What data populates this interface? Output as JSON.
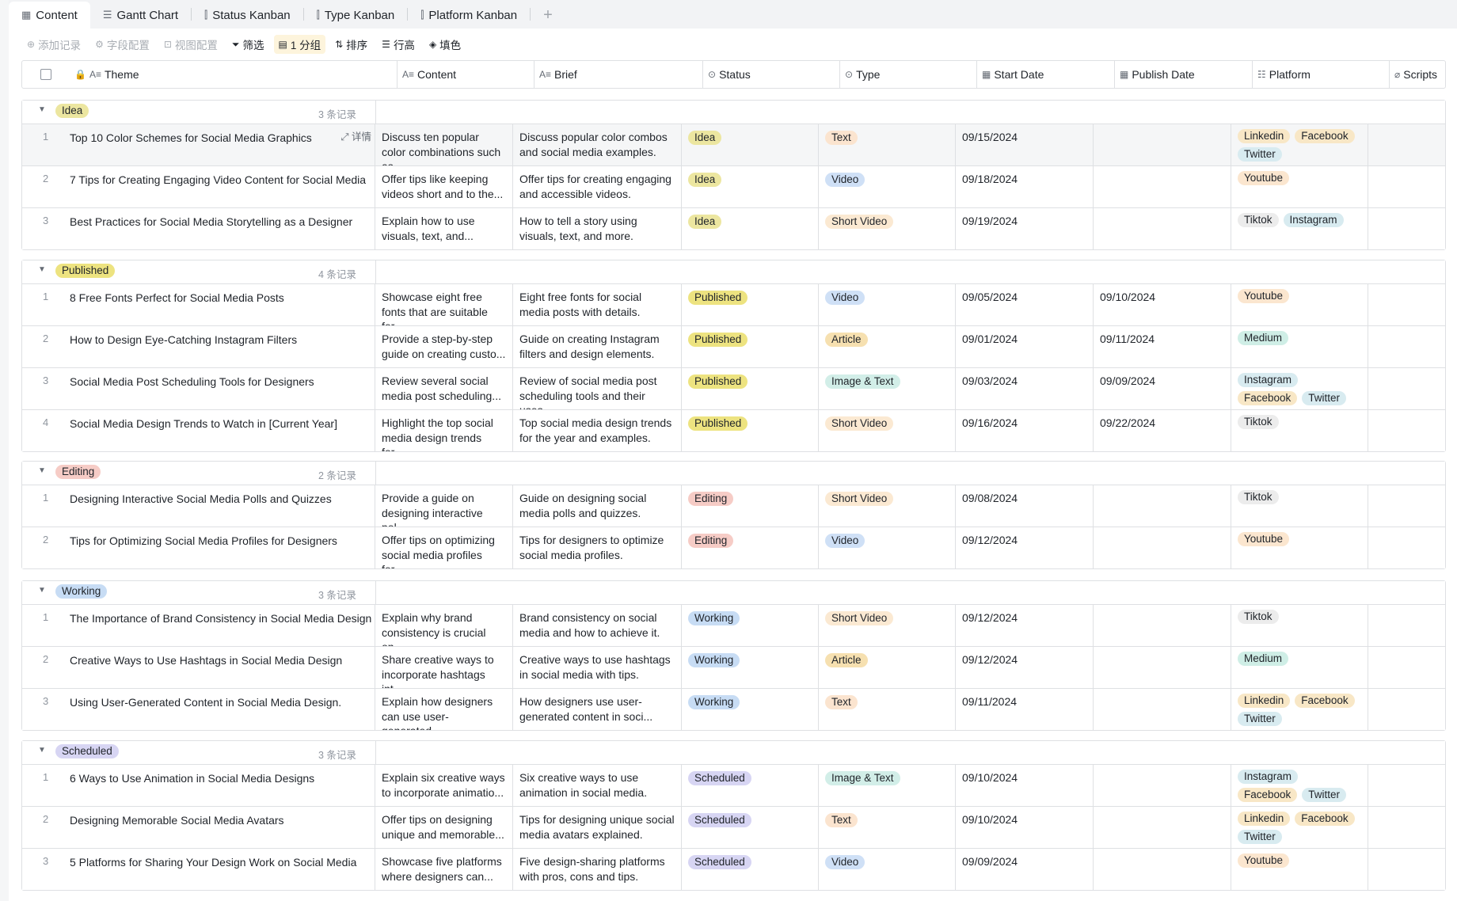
{
  "tabs": [
    {
      "label": "Content",
      "icon": "grid-table-icon",
      "active": true
    },
    {
      "label": "Gantt Chart",
      "icon": "gantt-icon",
      "active": false
    },
    {
      "label": "Status Kanban",
      "icon": "kanban-icon",
      "active": false
    },
    {
      "label": "Type Kanban",
      "icon": "kanban-icon",
      "active": false
    },
    {
      "label": "Platform Kanban",
      "icon": "kanban-icon",
      "active": false
    }
  ],
  "toolbar": {
    "add_record": "添加记录",
    "field_config": "字段配置",
    "view_config": "视图配置",
    "filter": "筛选",
    "group": "1 分组",
    "sort": "排序",
    "row_height": "行高",
    "fill_color": "填色"
  },
  "columns": {
    "theme": "Theme",
    "content": "Content",
    "brief": "Brief",
    "status": "Status",
    "type": "Type",
    "start_date": "Start Date",
    "publish_date": "Publish Date",
    "platform": "Platform",
    "scripts": "Scripts"
  },
  "detail_label": "详情",
  "groups": [
    {
      "label": "Idea",
      "count": "3 条记录",
      "status_class": "idea",
      "rows": [
        {
          "num": "1",
          "theme": "Top 10 Color Schemes for Social Media Graphics",
          "content": "Discuss ten popular color combinations such as...",
          "brief": "Discuss popular color combos and social media examples.",
          "status": "Idea",
          "type": "Text",
          "start": "09/15/2024",
          "publish": "",
          "platforms": [
            "Linkedin",
            "Facebook",
            "Twitter"
          ],
          "highlight": true
        },
        {
          "num": "2",
          "theme": "7 Tips for Creating Engaging Video Content for Social Media",
          "content": "Offer tips like keeping videos short and to the...",
          "brief": "Offer tips for creating engaging and accessible videos.",
          "status": "Idea",
          "type": "Video",
          "start": "09/18/2024",
          "publish": "",
          "platforms": [
            "Youtube"
          ]
        },
        {
          "num": "3",
          "theme": "Best Practices for Social Media Storytelling as a Designer",
          "content": "Explain how to use visuals, text, and...",
          "brief": "How to tell a story using visuals, text, and more.",
          "status": "Idea",
          "type": "Short Video",
          "start": "09/19/2024",
          "publish": "",
          "platforms": [
            "Tiktok",
            "Instagram"
          ]
        }
      ]
    },
    {
      "label": "Published",
      "count": "4 条记录",
      "status_class": "published",
      "rows": [
        {
          "num": "1",
          "theme": "8 Free Fonts Perfect for Social Media Posts",
          "content": "Showcase eight free fonts that are suitable for...",
          "brief": "Eight free fonts for social media posts with details.",
          "status": "Published",
          "type": "Video",
          "start": "09/05/2024",
          "publish": "09/10/2024",
          "platforms": [
            "Youtube"
          ]
        },
        {
          "num": "2",
          "theme": "How to Design Eye-Catching Instagram Filters",
          "content": "Provide a step-by-step guide on creating custo...",
          "brief": "Guide on creating Instagram filters and design elements.",
          "status": "Published",
          "type": "Article",
          "start": "09/01/2024",
          "publish": "09/11/2024",
          "platforms": [
            "Medium"
          ]
        },
        {
          "num": "3",
          "theme": "Social Media Post Scheduling Tools for Designers",
          "content": "Review several social media post scheduling...",
          "brief": "Review of social media post scheduling tools and their uses.",
          "status": "Published",
          "type": "Image & Text",
          "start": "09/03/2024",
          "publish": "09/09/2024",
          "platforms": [
            "Instagram",
            "Facebook",
            "Twitter"
          ]
        },
        {
          "num": "4",
          "theme": "Social Media Design Trends to Watch in [Current Year]",
          "content": "Highlight the top social media design trends for...",
          "brief": "Top social media design trends for the year and examples.",
          "status": "Published",
          "type": "Short Video",
          "start": "09/16/2024",
          "publish": "09/22/2024",
          "platforms": [
            "Tiktok"
          ]
        }
      ]
    },
    {
      "label": "Editing",
      "count": "2 条记录",
      "status_class": "editing",
      "rows": [
        {
          "num": "1",
          "theme": "Designing Interactive Social Media Polls and Quizzes",
          "content": "Provide a guide on designing interactive pol...",
          "brief": "Guide on designing social media polls and quizzes.",
          "status": "Editing",
          "type": "Short Video",
          "start": "09/08/2024",
          "publish": "",
          "platforms": [
            "Tiktok"
          ]
        },
        {
          "num": "2",
          "theme": "Tips for Optimizing Social Media Profiles for Designers",
          "content": "Offer tips on optimizing social media profiles for...",
          "brief": "Tips for designers to optimize social media profiles.",
          "status": "Editing",
          "type": "Video",
          "start": "09/12/2024",
          "publish": "",
          "platforms": [
            "Youtube"
          ]
        }
      ]
    },
    {
      "label": "Working",
      "count": "3 条记录",
      "status_class": "working",
      "rows": [
        {
          "num": "1",
          "theme": "The Importance of Brand Consistency in Social Media Design",
          "content": "Explain why brand consistency is crucial on...",
          "brief": "Brand consistency on social media and how to achieve it.",
          "status": "Working",
          "type": "Short Video",
          "start": "09/12/2024",
          "publish": "",
          "platforms": [
            "Tiktok"
          ]
        },
        {
          "num": "2",
          "theme": "Creative Ways to Use Hashtags in Social Media Design",
          "content": "Share creative ways to incorporate hashtags int...",
          "brief": "Creative ways to use hashtags in social media with tips.",
          "status": "Working",
          "type": "Article",
          "start": "09/12/2024",
          "publish": "",
          "platforms": [
            "Medium"
          ]
        },
        {
          "num": "3",
          "theme": "Using User-Generated Content in Social Media Design.",
          "content": "Explain how designers can use user-generated...",
          "brief": "How designers use user-generated content in soci...",
          "status": "Working",
          "type": "Text",
          "start": "09/11/2024",
          "publish": "",
          "platforms": [
            "Linkedin",
            "Facebook",
            "Twitter"
          ]
        }
      ]
    },
    {
      "label": "Scheduled",
      "count": "3 条记录",
      "status_class": "scheduled",
      "rows": [
        {
          "num": "1",
          "theme": "6 Ways to Use Animation in Social Media Designs",
          "content": "Explain six creative ways to incorporate animatio...",
          "brief": "Six creative ways to use animation in social media.",
          "status": "Scheduled",
          "type": "Image & Text",
          "start": "09/10/2024",
          "publish": "",
          "platforms": [
            "Instagram",
            "Facebook",
            "Twitter"
          ]
        },
        {
          "num": "2",
          "theme": "Designing Memorable Social Media Avatars",
          "content": "Offer tips on designing unique and memorable...",
          "brief": "Tips for designing unique social media avatars explained.",
          "status": "Scheduled",
          "type": "Text",
          "start": "09/10/2024",
          "publish": "",
          "platforms": [
            "Linkedin",
            "Facebook",
            "Twitter"
          ]
        },
        {
          "num": "3",
          "theme": "5 Platforms for Sharing Your Design Work on Social Media",
          "content": "Showcase five platforms where designers can...",
          "brief": "Five design-sharing platforms with pros, cons and tips.",
          "status": "Scheduled",
          "type": "Video",
          "start": "09/09/2024",
          "publish": "",
          "platforms": [
            "Youtube"
          ]
        }
      ]
    }
  ]
}
